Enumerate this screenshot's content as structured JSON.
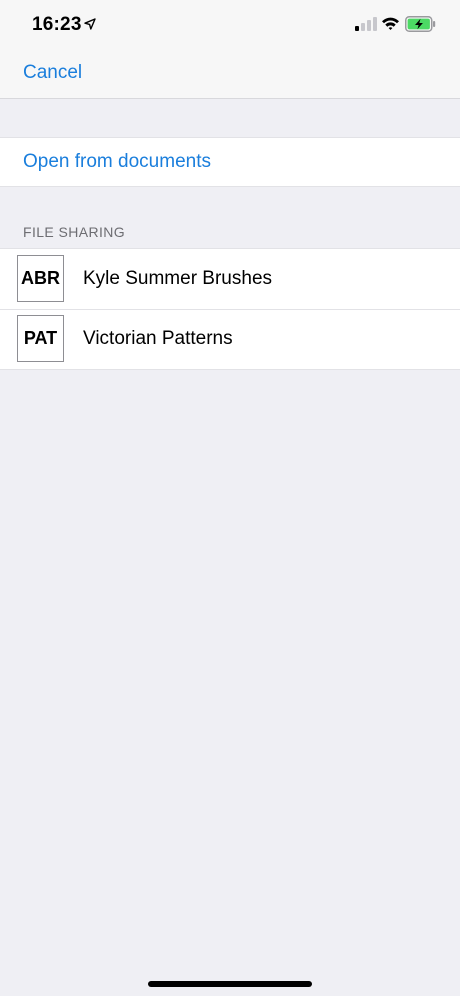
{
  "status_bar": {
    "time": "16:23",
    "icons": [
      "location-icon",
      "signal-icon",
      "wifi-icon",
      "battery-charging-icon"
    ],
    "battery_color": "#4cd964"
  },
  "nav": {
    "cancel_label": "Cancel"
  },
  "actions": {
    "open_from_documents": "Open from documents"
  },
  "file_sharing": {
    "header": "FILE SHARING",
    "items": [
      {
        "thumb": "ABR",
        "name": "Kyle Summer Brushes"
      },
      {
        "thumb": "PAT",
        "name": "Victorian Patterns"
      }
    ]
  },
  "colors": {
    "accent": "#1a7edc",
    "background": "#efeff4"
  }
}
